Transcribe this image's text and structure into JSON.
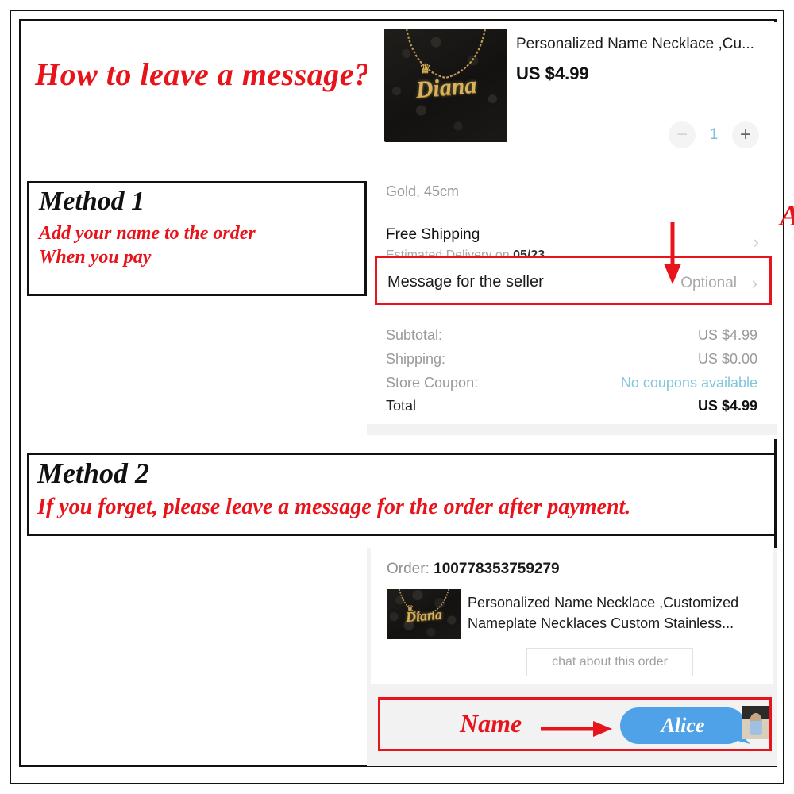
{
  "headline": "How to leave a message?",
  "method1": {
    "title": "Method 1",
    "line1": "Add your name to the order",
    "line2": "When you pay"
  },
  "method2": {
    "title": "Method 2",
    "line1": "If you forget, please leave a message for the order after payment."
  },
  "checkout": {
    "product_title": "Personalized Name Necklace ,Cu...",
    "price": "US $4.99",
    "quantity": "1",
    "minus_label": "−",
    "plus_label": "+",
    "variant": "Gold, 45cm",
    "shipping_title": "Free Shipping",
    "shipping_sub_prefix": "Estimated Delivery on ",
    "shipping_sub_date": "05/23",
    "chevron": "›",
    "message_label": "Message for the seller",
    "message_value": "Optional",
    "annotation_name": "Alice",
    "necklace_name": "Diana",
    "crown_glyph": "♛",
    "summary": [
      {
        "key": "Subtotal:",
        "value": "US $4.99"
      },
      {
        "key": "Shipping:",
        "value": "US $0.00"
      },
      {
        "key": "Store Coupon:",
        "value": "No coupons available"
      },
      {
        "key": "Total",
        "value": "US $4.99"
      }
    ]
  },
  "order": {
    "order_prefix": "Order: ",
    "order_number": "100778353759279",
    "description": "Personalized Name Necklace ,Customized Nameplate Necklaces Custom Stainless...",
    "chat_button": "chat about this order",
    "name_note": "Name",
    "bubble_text": "Alice",
    "necklace_name": "Diana",
    "crown_glyph": "♛"
  },
  "colors": {
    "annotation_red": "#e8141c",
    "bubble_blue": "#4fa2e8",
    "coupon_link": "#82c6de",
    "qty_value": "#7fbde0",
    "frame_black": "#111111",
    "panel_gray": "#f2f2f2"
  }
}
